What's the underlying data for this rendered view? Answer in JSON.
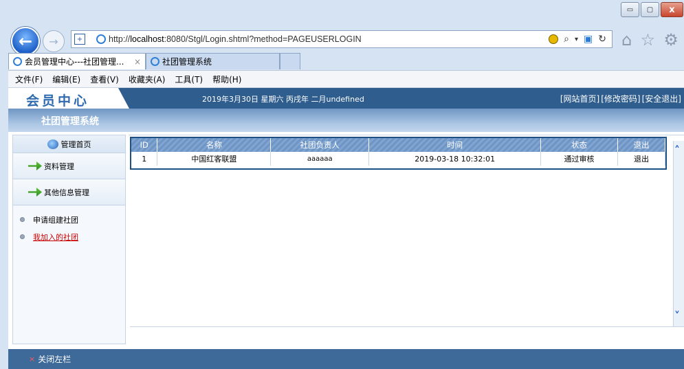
{
  "browser": {
    "url_prefix": "http://",
    "url_host": "localhost",
    "url_rest": ":8080/Stgl/Login.shtml?method=PAGEUSERLOGIN",
    "tabs": [
      {
        "label": "会员管理中心---社团管理...",
        "close": "×"
      },
      {
        "label": "社团管理系统"
      }
    ],
    "menu": [
      "文件(F)",
      "编辑(E)",
      "查看(V)",
      "收藏夹(A)",
      "工具(T)",
      "帮助(H)"
    ],
    "window_controls": {
      "min": "▭",
      "max": "▢",
      "close": "x"
    }
  },
  "header": {
    "logo": "会员中心",
    "date": "2019年3月30日 星期六 丙戌年 二月undefined",
    "links": [
      "[网站首页]",
      "[修改密码]",
      "[安全退出]"
    ],
    "system_title": "社团管理系统"
  },
  "sidebar": {
    "home": "管理首页",
    "blocks": [
      "资料管理",
      "其他信息管理"
    ],
    "items": [
      {
        "label": "申请组建社团",
        "active": false
      },
      {
        "label": "我加入的社团",
        "active": true
      }
    ]
  },
  "table": {
    "columns": [
      "ID",
      "名称",
      "社团负责人",
      "时间",
      "状态",
      "退出"
    ],
    "rows": [
      [
        "1",
        "中国红客联盟",
        "aaaaaa",
        "2019-03-18 10:32:01",
        "通过审核",
        "退出"
      ]
    ]
  },
  "footer": {
    "close_left": "关闭左栏",
    "close_mark": "×"
  },
  "colors": {
    "header_bg": "#2e5d8e",
    "footer_bg": "#3d6a99",
    "active_link": "#cc0000"
  }
}
